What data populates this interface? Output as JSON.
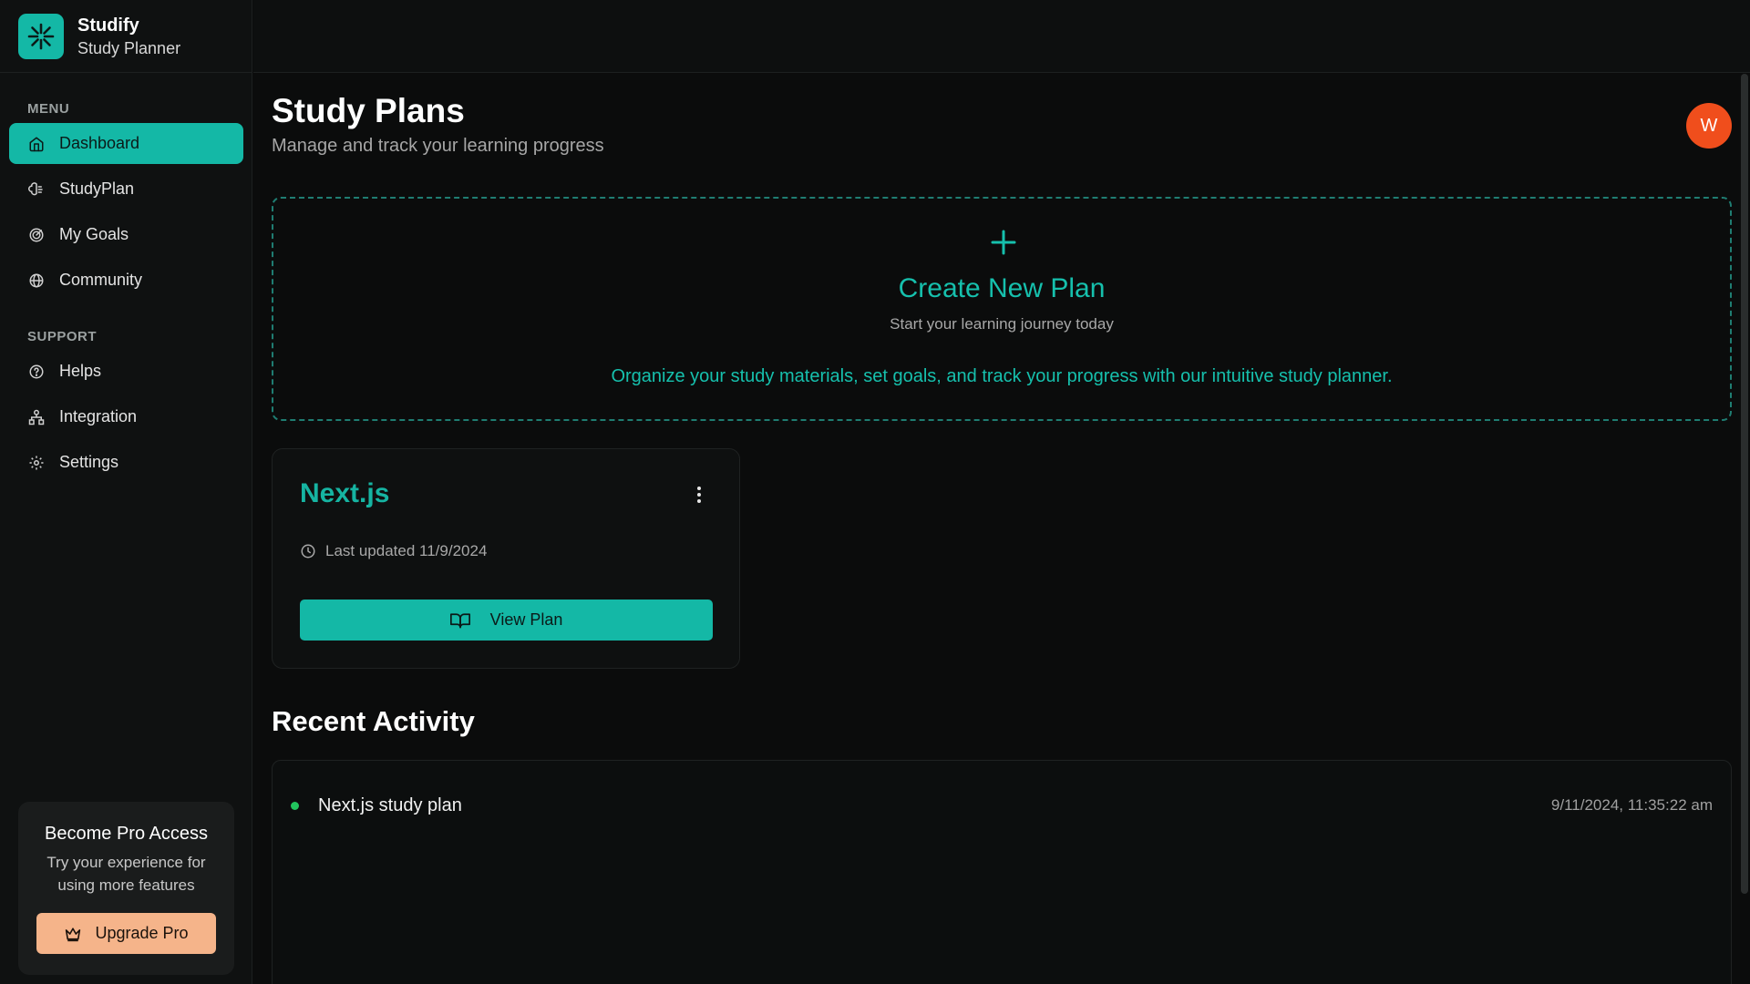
{
  "brand": {
    "name": "Studify",
    "subtitle": "Study Planner",
    "color": "#14b8a6"
  },
  "sidebar": {
    "menu_label": "MENU",
    "menu_items": [
      {
        "label": "Dashboard",
        "icon": "home-icon",
        "active": true
      },
      {
        "label": "StudyPlan",
        "icon": "brain-icon",
        "active": false
      },
      {
        "label": "My Goals",
        "icon": "target-icon",
        "active": false
      },
      {
        "label": "Community",
        "icon": "globe-icon",
        "active": false
      }
    ],
    "support_label": "SUPPORT",
    "support_items": [
      {
        "label": "Helps",
        "icon": "help-circle-icon"
      },
      {
        "label": "Integration",
        "icon": "network-icon"
      },
      {
        "label": "Settings",
        "icon": "gear-icon"
      }
    ],
    "pro": {
      "title": "Become Pro Access",
      "description": "Try your experience for using more features",
      "button_label": "Upgrade Pro",
      "button_icon": "crown-icon"
    }
  },
  "header": {
    "title": "Study Plans",
    "subtitle": "Manage and track your learning progress",
    "avatar_initial": "W",
    "avatar_color": "#f04e1c"
  },
  "create": {
    "icon": "plus-icon",
    "title": "Create New Plan",
    "subtitle": "Start your learning journey today",
    "description": "Organize your study materials, set goals, and track your progress with our intuitive study planner."
  },
  "plans": [
    {
      "name": "Next.js",
      "updated": "Last updated 11/9/2024",
      "button_label": "View Plan",
      "button_icon": "book-open-icon"
    }
  ],
  "recent": {
    "title": "Recent Activity",
    "items": [
      {
        "text": "Next.js study plan",
        "time": "9/11/2024, 11:35:22 am",
        "status_color": "#22c55e"
      }
    ]
  }
}
